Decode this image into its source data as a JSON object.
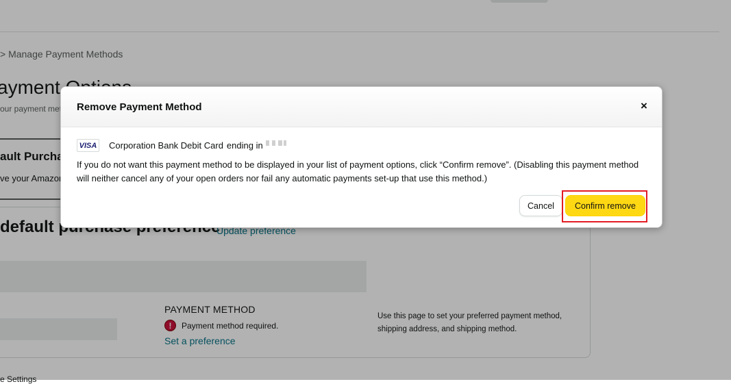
{
  "background": {
    "breadcrumb": "> Manage Payment Methods",
    "title": "ayment Options",
    "subtitle": "our payment methods",
    "tab": {
      "title": "ault Purchase",
      "subtitle": "ve your Amazon"
    },
    "preference_section": {
      "heading": "default purchase preference",
      "update_link": "Update preference",
      "payment_method_label": "PAYMENT METHOD",
      "error_text": "Payment method required.",
      "set_preference_link": "Set a preference",
      "side_note": "Use this page to set your preferred payment method, shipping address, and shipping method."
    },
    "cut_text": "e Settings"
  },
  "modal": {
    "title": "Remove Payment Method",
    "close_label": "×",
    "card": {
      "brand": "VISA",
      "name": "Corporation Bank Debit Card",
      "ending_label": "ending in"
    },
    "message": "If you do not want this payment method to be displayed in your list of payment options, click “Confirm remove”. (Disabling this payment method will neither cancel any of your open orders nor fail any automatic payments set-up that use this method.)",
    "cancel_label": "Cancel",
    "confirm_label": "Confirm remove"
  },
  "colors": {
    "confirm_button": "#ffd814",
    "highlight": "#e31b23",
    "link": "#007185",
    "error": "#cc0c39"
  }
}
